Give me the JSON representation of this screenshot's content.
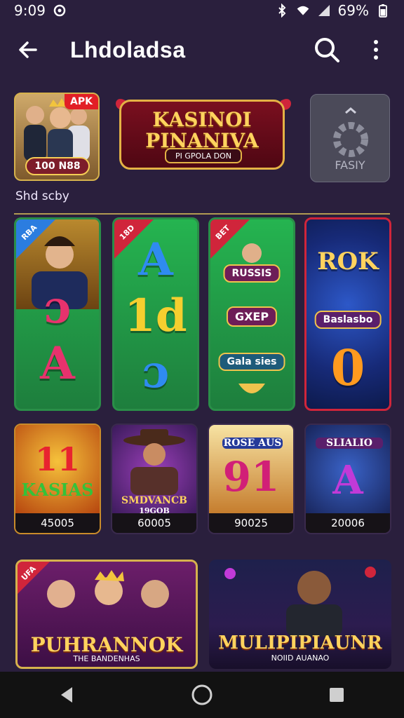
{
  "status": {
    "time": "9:09",
    "battery": "69%",
    "icons": [
      "media-icon",
      "bluetooth-icon",
      "wifi-icon",
      "signal-icon",
      "battery-icon"
    ]
  },
  "appbar": {
    "title": "Lhdoladsa",
    "icons": [
      "arrow-left-icon",
      "search-icon",
      "more-vert-icon"
    ]
  },
  "featured": {
    "card1": {
      "badge": "APK",
      "price": "100 N88"
    },
    "caption": "Shd scby",
    "card2": {
      "title_line1": "KASINOI",
      "title_line2": "PINANIVA",
      "subtitle": "PI GPOLA DON"
    },
    "card3": {
      "label": "FASIY"
    }
  },
  "games": {
    "tall": [
      {
        "symbols": [
          "ɔ",
          "A"
        ],
        "badge": "RBA"
      },
      {
        "symbols": [
          "A",
          "1d",
          "ɔ"
        ],
        "badge": "18D"
      },
      {
        "labels": [
          "RUSSIS",
          "GXEP",
          "Gala sies"
        ],
        "badge": "BET"
      },
      {
        "title": "ROK",
        "label": "Baslasbo",
        "symbol": "0"
      }
    ],
    "small": [
      {
        "title_line1": "11",
        "title_line2": "KASIAS",
        "value": "45005"
      },
      {
        "title_line1": "SMDVANCB",
        "title_line2": "19GOB",
        "value": "60005"
      },
      {
        "title_line1": "ROSE AUS",
        "title_line2": "91",
        "value": "90025"
      },
      {
        "title_line1": "SLIALIO",
        "title_line2": "A",
        "value": "20006"
      }
    ]
  },
  "banners": [
    {
      "title": "PUHRANNOK",
      "subtitle": "THE BANDENHAS",
      "badge": "UFA"
    },
    {
      "title": "MULIPIPIAUNR",
      "subtitle": "NOIID AUANAO"
    }
  ],
  "colors": {
    "background": "#2a1f3d",
    "gold": "#d6b24d",
    "red_accent": "#d0253b",
    "green_card": "#25b450"
  }
}
